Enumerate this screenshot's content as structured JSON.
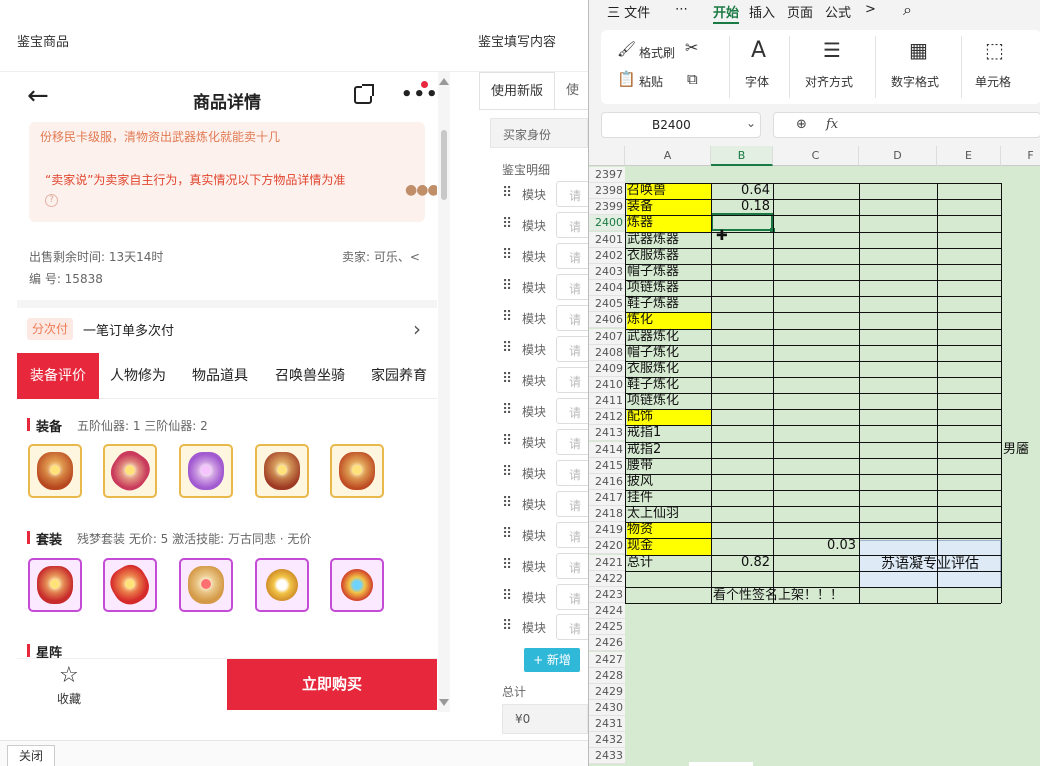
{
  "left": {
    "header": "鉴宝商品",
    "nav_title": "商品详情",
    "notice_line1": "份移民卡级服，清物资出武器炼化就能卖十几",
    "notice_line2": "“卖家说”为卖家自主行为，真实情况以下方物品详情为准",
    "remaining_time": "出售剩余时间: 13天14时",
    "seller": "卖家: 可乐、<",
    "serial": "编 号: 15838",
    "installment_badge": "分次付",
    "installment_label": "一笔订单多次付",
    "tabs": [
      "装备评价",
      "人物修为",
      "物品道具",
      "召唤兽坐骑",
      "家园养育"
    ],
    "equip_title": "装备",
    "equip_sub": "五阶仙器: 1   三阶仙器: 2",
    "set_title": "套装",
    "set_sub": "残梦套装   无价: 5   激活技能: 万古同悲 · 无价",
    "star_title": "星阵",
    "fav_label": "收藏",
    "buy_label": "立即购买"
  },
  "mid": {
    "header": "鉴宝填写内容",
    "tab_active": "使用新版",
    "tab_other": "使用",
    "seller_identity": "买家身份",
    "detail_label": "鉴宝明细",
    "module_label": "模块",
    "module_placeholder": "请",
    "add_label": "+ 新增",
    "total_label": "总计",
    "total_value": "¥0"
  },
  "bottom": {
    "close_label": "关闭"
  },
  "sheet": {
    "menu": [
      "三 文件",
      "⋯",
      "开始",
      "插入",
      "页面",
      "公式",
      ">"
    ],
    "ribbon": {
      "format_painter": "格式刷",
      "paste": "粘贴",
      "font": "字体",
      "align": "对齐方式",
      "number": "数字格式",
      "cell": "单元格"
    },
    "name_box": "B2400",
    "columns": [
      "A",
      "B",
      "C",
      "D",
      "E",
      "F"
    ],
    "rows": [
      {
        "n": "2397",
        "a": "",
        "b": "",
        "c": "",
        "f": "",
        "hl": false
      },
      {
        "n": "2398",
        "a": "召唤兽",
        "b": "0.64",
        "c": "",
        "f": "",
        "hl": true
      },
      {
        "n": "2399",
        "a": "装备",
        "b": "0.18",
        "c": "",
        "f": "",
        "hl": true
      },
      {
        "n": "2400",
        "a": "炼器",
        "b": "",
        "c": "",
        "f": "",
        "hl": true
      },
      {
        "n": "2401",
        "a": "武器炼器",
        "b": "",
        "c": "",
        "f": "",
        "hl": false
      },
      {
        "n": "2402",
        "a": "衣服炼器",
        "b": "",
        "c": "",
        "f": "",
        "hl": false
      },
      {
        "n": "2403",
        "a": "帽子炼器",
        "b": "",
        "c": "",
        "f": "",
        "hl": false
      },
      {
        "n": "2404",
        "a": "项链炼器",
        "b": "",
        "c": "",
        "f": "",
        "hl": false
      },
      {
        "n": "2405",
        "a": "鞋子炼器",
        "b": "",
        "c": "",
        "f": "",
        "hl": false
      },
      {
        "n": "2406",
        "a": "炼化",
        "b": "",
        "c": "",
        "f": "",
        "hl": true
      },
      {
        "n": "2407",
        "a": "武器炼化",
        "b": "",
        "c": "",
        "f": "",
        "hl": false
      },
      {
        "n": "2408",
        "a": "帽子炼化",
        "b": "",
        "c": "",
        "f": "",
        "hl": false
      },
      {
        "n": "2409",
        "a": "衣服炼化",
        "b": "",
        "c": "",
        "f": "",
        "hl": false
      },
      {
        "n": "2410",
        "a": "鞋子炼化",
        "b": "",
        "c": "",
        "f": "",
        "hl": false
      },
      {
        "n": "2411",
        "a": "项链炼化",
        "b": "",
        "c": "",
        "f": "",
        "hl": false
      },
      {
        "n": "2412",
        "a": "配饰",
        "b": "",
        "c": "",
        "f": "",
        "hl": true
      },
      {
        "n": "2413",
        "a": "戒指1",
        "b": "",
        "c": "",
        "f": "",
        "hl": false
      },
      {
        "n": "2414",
        "a": "戒指2",
        "b": "",
        "c": "",
        "f": "男靥",
        "hl": false
      },
      {
        "n": "2415",
        "a": "腰带",
        "b": "",
        "c": "",
        "f": "",
        "hl": false
      },
      {
        "n": "2416",
        "a": "披风",
        "b": "",
        "c": "",
        "f": "",
        "hl": false
      },
      {
        "n": "2417",
        "a": "挂件",
        "b": "",
        "c": "",
        "f": "",
        "hl": false
      },
      {
        "n": "2418",
        "a": "太上仙羽",
        "b": "",
        "c": "",
        "f": "",
        "hl": false
      },
      {
        "n": "2419",
        "a": "物资",
        "b": "",
        "c": "",
        "f": "",
        "hl": true
      },
      {
        "n": "2420",
        "a": "现金",
        "b": "",
        "c": "0.03",
        "f": "",
        "hl": true
      },
      {
        "n": "2421",
        "a": "总计",
        "b": "0.82",
        "c": "",
        "f": "",
        "hl": false
      },
      {
        "n": "2422",
        "a": "",
        "b": "",
        "c": "",
        "f": "",
        "hl": false
      },
      {
        "n": "2423",
        "a": "",
        "b": "",
        "c": "",
        "f": "",
        "hl": false
      },
      {
        "n": "2424",
        "a": "",
        "b": "",
        "c": "",
        "f": "",
        "hl": false
      },
      {
        "n": "2425",
        "a": "",
        "b": "",
        "c": "",
        "f": "",
        "hl": false
      },
      {
        "n": "2426",
        "a": "",
        "b": "",
        "c": "",
        "f": "",
        "hl": false
      },
      {
        "n": "2427",
        "a": "",
        "b": "",
        "c": "",
        "f": "",
        "hl": false
      },
      {
        "n": "2428",
        "a": "",
        "b": "",
        "c": "",
        "f": "",
        "hl": false
      },
      {
        "n": "2429",
        "a": "",
        "b": "",
        "c": "",
        "f": "",
        "hl": false
      },
      {
        "n": "2430",
        "a": "",
        "b": "",
        "c": "",
        "f": "",
        "hl": false
      },
      {
        "n": "2431",
        "a": "",
        "b": "",
        "c": "",
        "f": "",
        "hl": false
      },
      {
        "n": "2432",
        "a": "",
        "b": "",
        "c": "",
        "f": "",
        "hl": false
      },
      {
        "n": "2433",
        "a": "",
        "b": "",
        "c": "",
        "f": "",
        "hl": false
      }
    ],
    "note_2423": "看个性签名上架！！！",
    "shape_text": "苏语凝专业评估",
    "colors": {
      "accent": "#1a7a43",
      "highlight": "#ffff00",
      "grid_bg": "#d6ead1"
    }
  },
  "colors": {
    "brand_red": "#e7273b",
    "add_blue": "#30b8d9"
  }
}
